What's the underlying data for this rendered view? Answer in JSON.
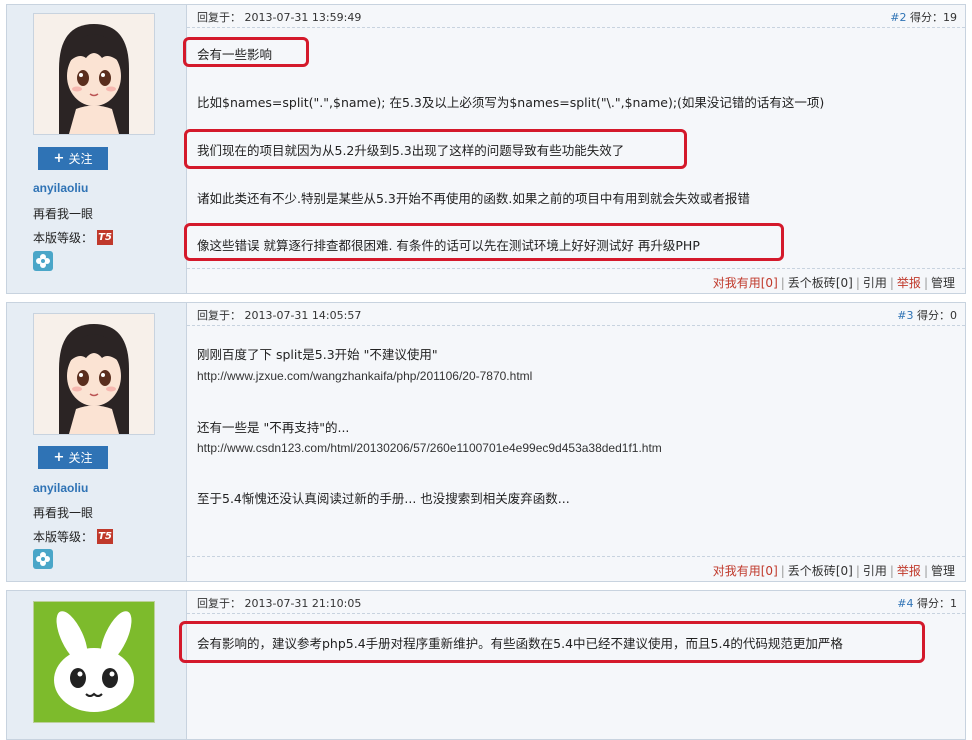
{
  "posts": [
    {
      "reply_label": "回复于：",
      "timestamp": "2013-07-31 13:59:49",
      "floor": "#2",
      "score_label": "得分：",
      "score": "19",
      "username": "anyilaoliu",
      "follow_label": "关注",
      "look_again": "再看我一眼",
      "level_label": "本版等级：",
      "level_badge": "T5",
      "lines": [
        "会有一些影响",
        "比如$names=split(\".\",$name);  在5.3及以上必须写为$names=split(\"\\.\",$name);(如果没记错的话有这一项)",
        "我们现在的项目就因为从5.2升级到5.3出现了这样的问题导致有些功能失效了",
        "诸如此类还有不少.特别是某些从5.3开始不再使用的函数.如果之前的项目中有用到就会失效或者报错",
        "像这些错误  就算逐行排查都很困难. 有条件的话可以先在测试环境上好好测试好 再升级PHP"
      ],
      "actions": {
        "useful": "对我有用",
        "useful_count": "[0]",
        "brick": "丢个板砖",
        "brick_count": "[0]",
        "quote": "引用",
        "report": "举报",
        "manage": "管理"
      }
    },
    {
      "reply_label": "回复于：",
      "timestamp": "2013-07-31 14:05:57",
      "floor": "#3",
      "score_label": "得分：",
      "score": "0",
      "username": "anyilaoliu",
      "follow_label": "关注",
      "look_again": "再看我一眼",
      "level_label": "本版等级：",
      "level_badge": "T5",
      "lines": [
        "刚刚百度了下  split是5.3开始 \"不建议使用\"",
        "http://www.jzxue.com/wangzhankaifa/php/201106/20-7870.html",
        "还有一些是 \"不再支持\"的...",
        "http://www.csdn123.com/html/20130206/57/260e1100701e4e99ec9d453a38ded1f1.htm",
        "至于5.4惭愧还没认真阅读过新的手册... 也没搜索到相关废弃函数..."
      ],
      "actions": {
        "useful": "对我有用",
        "useful_count": "[0]",
        "brick": "丢个板砖",
        "brick_count": "[0]",
        "quote": "引用",
        "report": "举报",
        "manage": "管理"
      }
    },
    {
      "reply_label": "回复于：",
      "timestamp": "2013-07-31 21:10:05",
      "floor": "#4",
      "score_label": "得分：",
      "score": "1",
      "lines": [
        "会有影响的，建议参考php5.4手册对程序重新维护。有些函数在5.4中已经不建议使用，而且5.4的代码规范更加严格"
      ]
    }
  ],
  "colors": {
    "accent": "#2f73b5",
    "highlight": "#d4192b",
    "panel": "#e6edf4"
  }
}
